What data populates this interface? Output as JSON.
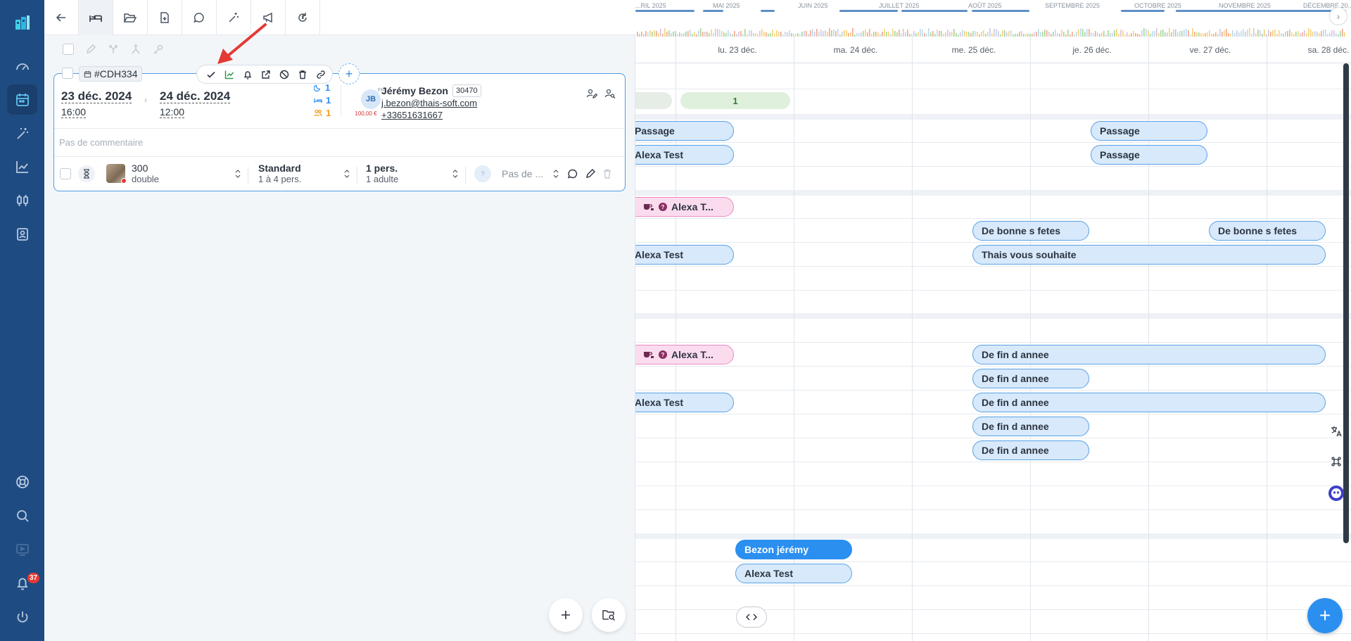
{
  "rail": {
    "notifications_count": "37",
    "items": [
      "logo-icon",
      "dashboard-icon",
      "calendar-icon",
      "magic-wand-icon",
      "chart-icon",
      "settings-sliders-icon",
      "contact-card-icon",
      "help-icon",
      "search-icon",
      "video-icon",
      "bell-icon",
      "power-icon"
    ]
  },
  "tabs": [
    "back-arrow-icon",
    "bed-icon",
    "folder-open-icon",
    "document-add-icon",
    "chat-icon",
    "magic-wand-icon",
    "megaphone-icon",
    "currency-refresh-icon"
  ],
  "booking": {
    "ref": "#CDH334",
    "arrival_date": "23 déc. 2024",
    "arrival_time": "16:00",
    "departure_date": "24 déc. 2024",
    "departure_time": "12:00",
    "nights": "1",
    "rooms": "1",
    "guests": "1",
    "client": {
      "initials": "JB",
      "flag": "FR",
      "amount": "100,00 €",
      "name": "Jérémy Bezon",
      "id": "30470",
      "email": "j.bezon@thais-soft.com",
      "phone": "+33651631667"
    },
    "comment_placeholder": "Pas de commentaire",
    "room": {
      "number": "300",
      "type": "double",
      "category": "Standard",
      "capacity": "1 à 4 pers.",
      "persons": "1 pers.",
      "adults": "1 adulte",
      "price_placeholder": "Pas de ...",
      "price_badge": "?"
    }
  },
  "timeline_months": [
    "...RIL 2025",
    "MAI 2025",
    "JUIN 2025",
    "JUILLET 2025",
    "AOÛT 2025",
    "SEPTEMBRE 2025",
    "OCTOBRE 2025",
    "NOVEMBRE 2025",
    "DÉCEMBRE 20..."
  ],
  "calendar": {
    "days": [
      "lu. 23 déc.",
      "ma. 24 déc.",
      "me. 25 déc.",
      "je. 26 déc.",
      "ve. 27 déc.",
      "sa. 28 déc."
    ],
    "count_label": "1",
    "events": {
      "passage_1": "Passage",
      "alexa_1": "Alexa Test",
      "passage_2": "Passage",
      "passage_3": "Passage",
      "alexa_pink_1": "Alexa T...",
      "bonnes_fetes_1": "De bonne s fetes",
      "bonnes_fetes_2": "De bonne s fetes",
      "alexa_2": "Alexa Test",
      "thais": "Thais vous souhaite",
      "alexa_pink_2": "Alexa T...",
      "fin_annee_1": "De fin d annee",
      "fin_annee_2": "De fin d annee",
      "alexa_3": "Alexa Test",
      "fin_annee_3": "De fin d annee",
      "fin_annee_4": "De fin d annee",
      "fin_annee_5": "De fin d annee",
      "bezon": "Bezon jérémy",
      "alexa_4": "Alexa Test"
    }
  },
  "colors": {
    "rail": "#1e4c82",
    "accent": "#2b8ff0",
    "event_fill": "#d7e9fb",
    "event_border": "#5aa2e6",
    "pink_event": "#fbdcef",
    "alert": "#e53935"
  }
}
